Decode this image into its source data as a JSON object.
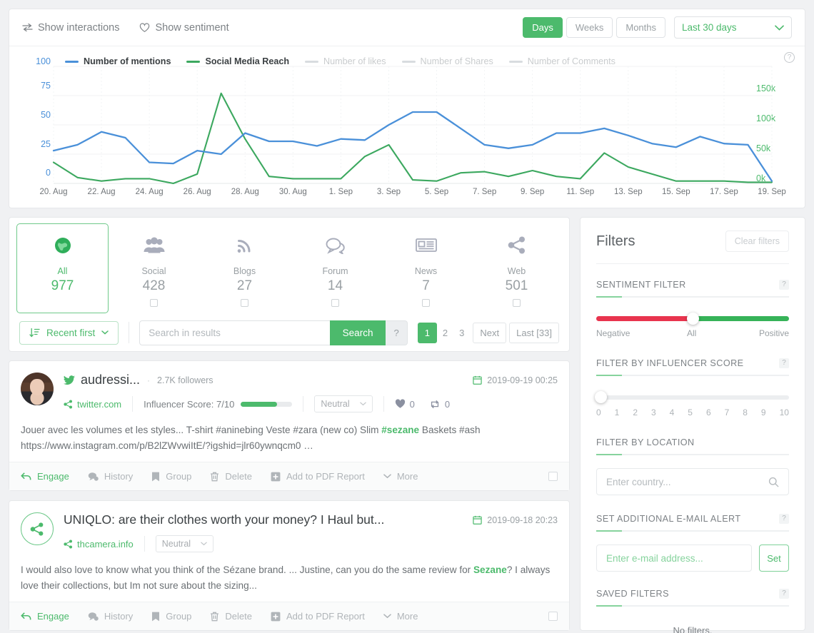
{
  "toolbar": {
    "show_interactions": "Show interactions",
    "show_sentiment": "Show sentiment",
    "segments": [
      "Days",
      "Weeks",
      "Months"
    ],
    "active_segment": "Days",
    "range_value": "Last 30 days"
  },
  "chart_data": {
    "type": "line",
    "title": "",
    "xlabel": "",
    "ylabel": "",
    "grid": true,
    "legend_position": "top",
    "y_left_ticks": [
      "0",
      "25",
      "50",
      "75",
      "100"
    ],
    "y_right_ticks": [
      "0k",
      "50k",
      "100k",
      "150k"
    ],
    "y_left_label_color": "#4a90d9",
    "y_right_label_color": "#4cba6c",
    "ylim_left": [
      0,
      100
    ],
    "ylim_right": [
      0,
      175000
    ],
    "x_tick_labels": [
      "20. Aug",
      "22. Aug",
      "24. Aug",
      "26. Aug",
      "28. Aug",
      "30. Aug",
      "1. Sep",
      "3. Sep",
      "5. Sep",
      "7. Sep",
      "9. Sep",
      "11. Sep",
      "13. Sep",
      "15. Sep",
      "17. Sep",
      "19. Sep"
    ],
    "x": [
      "20. Aug",
      "21. Aug",
      "22. Aug",
      "23. Aug",
      "24. Aug",
      "25. Aug",
      "26. Aug",
      "27. Aug",
      "28. Aug",
      "29. Aug",
      "30. Aug",
      "31. Aug",
      "1. Sep",
      "2. Sep",
      "3. Sep",
      "4. Sep",
      "5. Sep",
      "6. Sep",
      "7. Sep",
      "8. Sep",
      "9. Sep",
      "10. Sep",
      "11. Sep",
      "12. Sep",
      "13. Sep",
      "14. Sep",
      "15. Sep",
      "16. Sep",
      "17. Sep",
      "18. Sep",
      "19. Sep"
    ],
    "series": [
      {
        "name": "Number of mentions",
        "color": "#4a90d9",
        "active": true,
        "axis": "left",
        "values": [
          28,
          33,
          44,
          39,
          18,
          17,
          28,
          25,
          43,
          36,
          36,
          32,
          38,
          37,
          50,
          61,
          61,
          47,
          33,
          30,
          33,
          43,
          43,
          47,
          41,
          34,
          31,
          40,
          34,
          33,
          2
        ]
      },
      {
        "name": "Social Media Reach",
        "color": "#3ca85f",
        "active": true,
        "axis": "right",
        "values": [
          18,
          5,
          2,
          4,
          4,
          0,
          8,
          77,
          38,
          6,
          4,
          4,
          4,
          23,
          33,
          3,
          2,
          9,
          10,
          6,
          11,
          6,
          4,
          26,
          14,
          8,
          2,
          2,
          2,
          1,
          1
        ]
      },
      {
        "name": "Number of likes",
        "color": "#d8dcdf",
        "active": false,
        "axis": "right",
        "values": []
      },
      {
        "name": "Number of Shares",
        "color": "#d8dcdf",
        "active": false,
        "axis": "right",
        "values": []
      },
      {
        "name": "Number of Comments",
        "color": "#d8dcdf",
        "active": false,
        "axis": "right",
        "values": []
      }
    ]
  },
  "sources": {
    "items": [
      {
        "name": "All",
        "count": "977",
        "icon": "globe-icon",
        "active": true,
        "checkbox": false
      },
      {
        "name": "Social",
        "count": "428",
        "icon": "people-icon",
        "active": false,
        "checkbox": true
      },
      {
        "name": "Blogs",
        "count": "27",
        "icon": "rss-icon",
        "active": false,
        "checkbox": true
      },
      {
        "name": "Forum",
        "count": "14",
        "icon": "chat-icon",
        "active": false,
        "checkbox": true
      },
      {
        "name": "News",
        "count": "7",
        "icon": "newspaper-icon",
        "active": false,
        "checkbox": true
      },
      {
        "name": "Web",
        "count": "501",
        "icon": "share-icon",
        "active": false,
        "checkbox": true
      }
    ]
  },
  "search": {
    "sort_label": "Recent first",
    "placeholder": "Search in results",
    "value": "",
    "search_label": "Search",
    "help_label": "?",
    "pages": [
      "1",
      "2",
      "3",
      "Next",
      "Last [33]"
    ],
    "active_page": "1"
  },
  "results": [
    {
      "author": "audressi...",
      "network_icon": "twitter-icon",
      "followers": "2.7K  followers",
      "separator": "·",
      "date": "2019-09-19 00:25",
      "domain": "twitter.com",
      "score_label": "Influencer Score: 7/10",
      "score_percent": 70,
      "sentiment": "Neutral",
      "likes": "0",
      "retweets": "0",
      "text_before": "Jouer avec les volumes et les styles... T-shirt #aninebing Veste #zara (new co) Slim ",
      "highlight": "#sezane",
      "text_after": " Baskets #ash https://www.instagram.com/p/B2lZWvwiItE/?igshid=jlr60ywnqcm0 …"
    },
    {
      "title": "UNIQLO: are their clothes worth your money? I Haul but...",
      "network_icon": "share-icon",
      "date": "2019-09-18 20:23",
      "domain": "thcamera.info",
      "sentiment": "Neutral",
      "text_before": "I would also love to know what you think of the Sézane brand. ... Justine, can you do the same review for ",
      "highlight": "Sezane",
      "text_after": "? I always love their collections, but Im not sure about the sizing..."
    }
  ],
  "actions": [
    "Engage",
    "History",
    "Group",
    "Delete",
    "Add to PDF Report",
    "More"
  ],
  "filters": {
    "title": "Filters",
    "clear_label": "Clear filters",
    "sentiment": {
      "label": "SENTIMENT FILTER",
      "negative": "Negative",
      "all": "All",
      "positive": "Positive",
      "negative_color": "#e8344e",
      "positive_color": "#36b358",
      "value": 50
    },
    "influencer": {
      "label": "FILTER BY INFLUENCER SCORE",
      "ticks": [
        "0",
        "1",
        "2",
        "3",
        "4",
        "5",
        "6",
        "7",
        "8",
        "9",
        "10"
      ],
      "value": 0
    },
    "location": {
      "label": "FILTER BY LOCATION",
      "placeholder": "Enter country...",
      "value": ""
    },
    "email": {
      "label": "SET ADDITIONAL E-MAIL ALERT",
      "placeholder": "Enter e-mail address...",
      "value": "",
      "set_label": "Set"
    },
    "saved": {
      "label": "SAVED FILTERS",
      "empty": "No filters."
    },
    "help_label": "?"
  }
}
